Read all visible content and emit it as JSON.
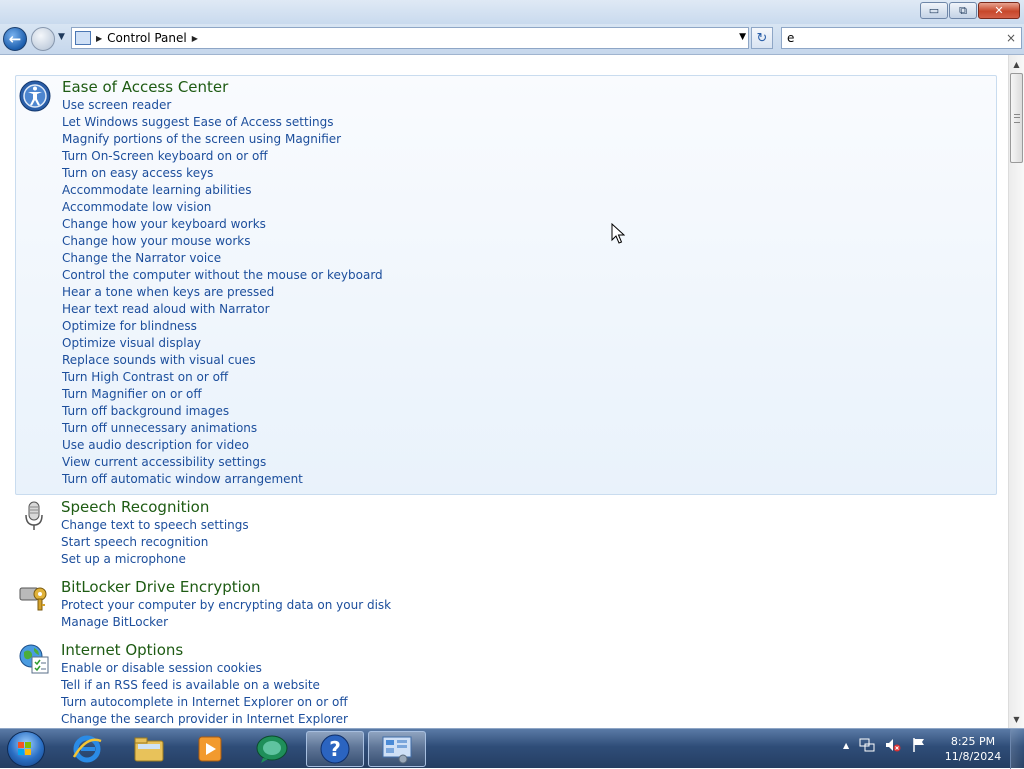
{
  "window": {
    "minimize_glyph": "▭",
    "maximize_glyph": "⧉",
    "close_glyph": "✕"
  },
  "nav": {
    "back_glyph": "←",
    "breadcrumb": [
      "Control Panel"
    ],
    "refresh_glyph": "↻",
    "search_value": "e",
    "search_clear_glyph": "×"
  },
  "results": [
    {
      "title": "Ease of Access Center",
      "icon": "ease-of-access-icon",
      "selected": true,
      "links": [
        "Use screen reader",
        "Let Windows suggest Ease of Access settings",
        "Magnify portions of the screen using Magnifier",
        "Turn On-Screen keyboard on or off",
        "Turn on easy access keys",
        "Accommodate learning abilities",
        "Accommodate low vision",
        "Change how your keyboard works",
        "Change how your mouse works",
        "Change the Narrator voice",
        "Control the computer without the mouse or keyboard",
        "Hear a tone when keys are pressed",
        "Hear text read aloud with Narrator",
        "Optimize for blindness",
        "Optimize visual display",
        "Replace sounds with visual cues",
        "Turn High Contrast on or off",
        "Turn Magnifier on or off",
        "Turn off background images",
        "Turn off unnecessary animations",
        "Use audio description for video",
        "View current accessibility settings",
        "Turn off automatic window arrangement"
      ]
    },
    {
      "title": "Speech Recognition",
      "icon": "microphone-icon",
      "links": [
        "Change text to speech settings",
        "Start speech recognition",
        "Set up a microphone"
      ]
    },
    {
      "title": "BitLocker Drive Encryption",
      "icon": "bitlocker-keys-icon",
      "links": [
        "Protect your computer by encrypting data on your disk",
        "Manage BitLocker"
      ]
    },
    {
      "title": "Internet Options",
      "icon": "internet-options-globe-icon",
      "links": [
        "Enable or disable session cookies",
        "Tell if an RSS feed is available on a website",
        "Turn autocomplete in Internet Explorer on or off",
        "Change the search provider in Internet Explorer"
      ]
    }
  ],
  "taskbar": {
    "apps": [
      "internet-explorer-icon",
      "windows-explorer-icon",
      "media-player-icon",
      "chat-bubble-icon",
      "help-icon",
      "control-panel-icon"
    ],
    "tray_show_glyph": "▲",
    "time": "8:25 PM",
    "date": "11/8/2024"
  },
  "colors": {
    "link": "#1c4e9c",
    "group_title": "#1e5b13",
    "selected_bg": "#eaf3fb",
    "taskbar": "#2f4d78"
  }
}
